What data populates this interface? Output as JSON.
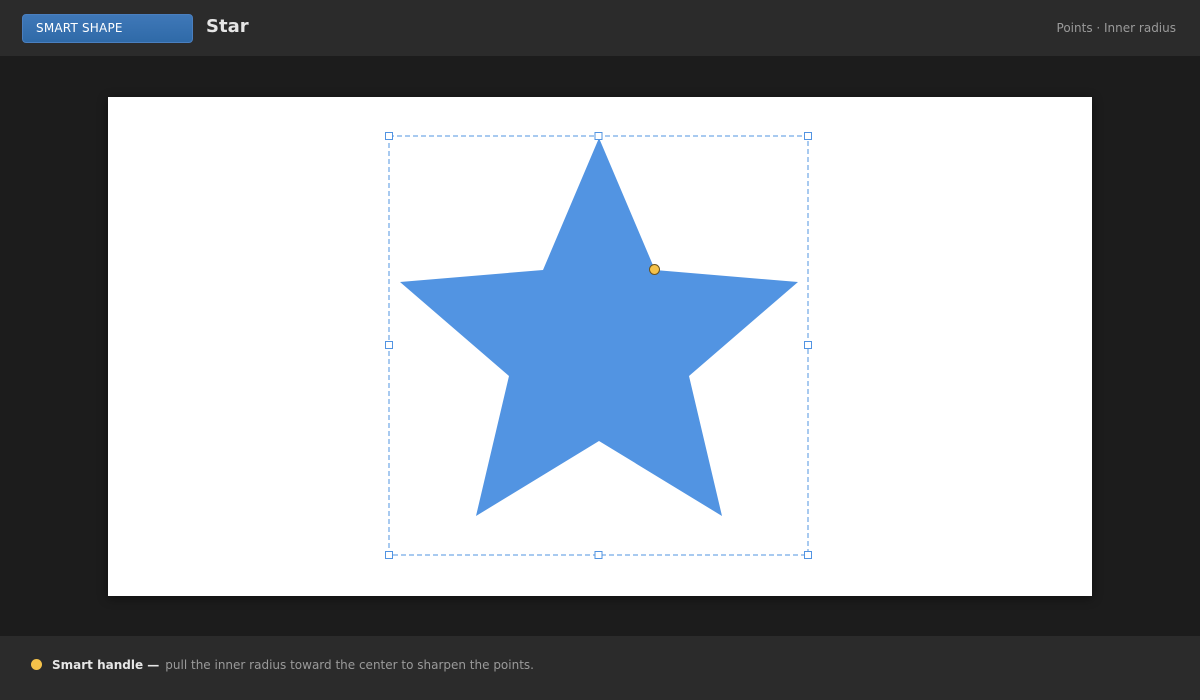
{
  "header": {
    "mode_label": "SMART SHAPE",
    "shape_name": "Star",
    "hint": "Points · Inner radius"
  },
  "colors": {
    "accent": "#3a74b4",
    "star_fill": "#5294e2",
    "selection": "#5294e2",
    "smart_handle": "#f5c24a"
  },
  "shape": {
    "type": "star",
    "points": 5
  },
  "footer": {
    "icon": "smart-handle-dot-icon",
    "bold": "Smart handle —",
    "description": "pull the inner radius toward the center to sharpen the points."
  }
}
